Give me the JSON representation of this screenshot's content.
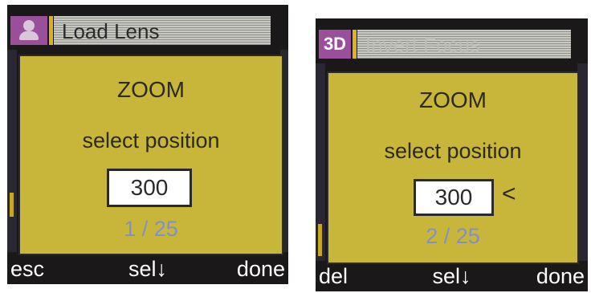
{
  "screens": [
    {
      "title": "Load Lens",
      "mode_icon": "person-icon",
      "dialog": {
        "heading": "ZOOM",
        "prompt": "select position",
        "value": "300",
        "counter": "1 / 25"
      },
      "softkeys": {
        "left": "esc",
        "middle": "sel",
        "middle_arrow": "↓",
        "right": "done"
      }
    },
    {
      "title": "Invert Focus",
      "mode_label": "3D",
      "dialog": {
        "heading": "ZOOM",
        "prompt": "select position",
        "value": "300",
        "caret": "<",
        "counter": "2 / 25"
      },
      "softkeys": {
        "left": "del",
        "middle": "sel",
        "middle_arrow": "↓",
        "right": "done"
      }
    }
  ],
  "colors": {
    "dialog_bg": "#c8b63a",
    "counter": "#8191c8",
    "badge": "#9a4f9a",
    "screen_bg": "#1a1818"
  }
}
